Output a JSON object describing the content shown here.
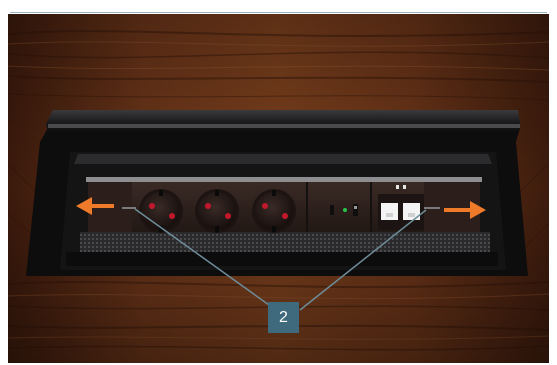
{
  "figure": {
    "callout_label": "2"
  },
  "colors": {
    "wood_dark": "#3b1a0c",
    "wood_mid": "#6b3519",
    "wood_light": "#9a5a2c",
    "frame_black": "#0f0f10",
    "socket_dark": "#2a1e1a",
    "socket_red": "#c2182b",
    "arrow_orange": "#ee7a2a",
    "callout_blue": "#3f6a7d"
  }
}
